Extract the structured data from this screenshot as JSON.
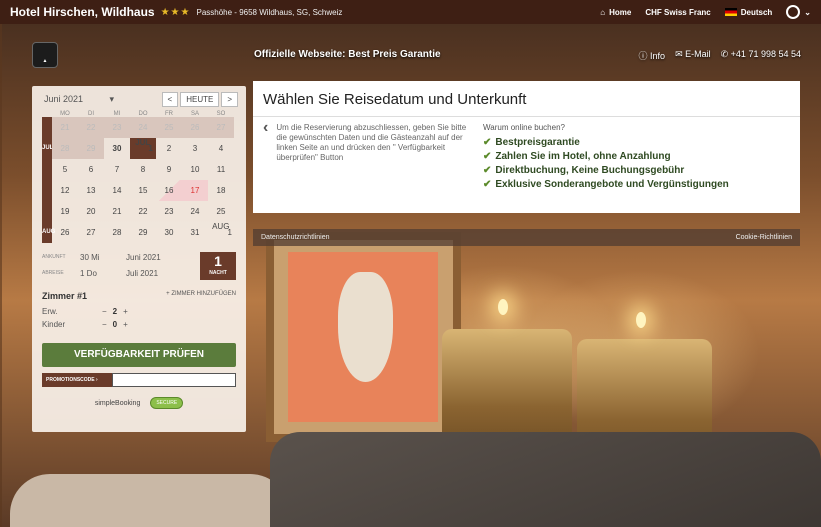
{
  "topbar": {
    "hotel_name": "Hotel Hirschen, Wildhaus",
    "stars": "★★★",
    "address": "Passhöhe - 9658 Wildhaus, SG, Schweiz",
    "home": "Home",
    "currency": "CHF  Swiss Franc",
    "language": "Deutsch"
  },
  "header": {
    "tagline": "Offizielle Webseite: Best Preis Garantie",
    "info": "Info",
    "email": "E-Mail",
    "phone": "+41 71 998 54 54"
  },
  "calendar": {
    "month_select": "Juni 2021",
    "today": "HEUTE",
    "prev": "<",
    "next": ">",
    "dows": [
      "MO",
      "DI",
      "MI",
      "DO",
      "FR",
      "SA",
      "SO"
    ],
    "weeks": [
      {
        "label": "",
        "days": [
          "21",
          "22",
          "23",
          "24",
          "25",
          "26",
          "27"
        ]
      },
      {
        "label": "JUL",
        "days": [
          "28",
          "29",
          "30",
          "1",
          "2",
          "3",
          "4"
        ]
      },
      {
        "label": "",
        "days": [
          "5",
          "6",
          "7",
          "8",
          "9",
          "10",
          "11"
        ]
      },
      {
        "label": "",
        "days": [
          "12",
          "13",
          "14",
          "15",
          "16",
          "17",
          "18"
        ]
      },
      {
        "label": "",
        "days": [
          "19",
          "20",
          "21",
          "22",
          "23",
          "24",
          "25"
        ]
      },
      {
        "label": "AUG",
        "days": [
          "26",
          "27",
          "28",
          "29",
          "30",
          "31",
          "1"
        ]
      }
    ],
    "mini_jul": "JUL",
    "mini_aug": "AUG"
  },
  "form": {
    "arrival_label": "ANKUNFT",
    "arrival_day": "30 Mi",
    "arrival_month": "Juni 2021",
    "departure_label": "ABREISE",
    "departure_day": "1 Do",
    "departure_month": "Juli 2021",
    "nights": "1",
    "nights_label": "NACHT",
    "room_title": "Zimmer #1",
    "add_room": "+ ZIMMER HINZUFÜGEN",
    "adults_label": "Erw.",
    "adults": "2",
    "children_label": "Kinder",
    "children": "0",
    "check_button": "VERFÜGBARKEIT PRÜFEN",
    "promo_label": "PROMOTIONSCODE ›",
    "brand": "simpleBooking",
    "secure": "SECURE"
  },
  "main": {
    "title": "Wählen Sie Reisedatum und Unterkunft",
    "hint": "Um die Reservierung abzuschliessen, geben Sie bitte die gewünschten Daten und die Gästeanzahl auf der linken Seite an und drücken den \" Verfügbarkeit überprüfen\" Button",
    "why_title": "Warum online buchen?",
    "benefits": [
      "Bestpreisgarantie",
      "Zahlen Sie im Hotel, ohne Anzahlung",
      "Direktbuchung, Keine Buchungsgebühr",
      "Exklusive Sonderangebote und Vergünstigungen"
    ]
  },
  "footer_bar": {
    "privacy": "Datenschutzrichtlinien",
    "cookies": "Cookie-Richtlinien"
  }
}
